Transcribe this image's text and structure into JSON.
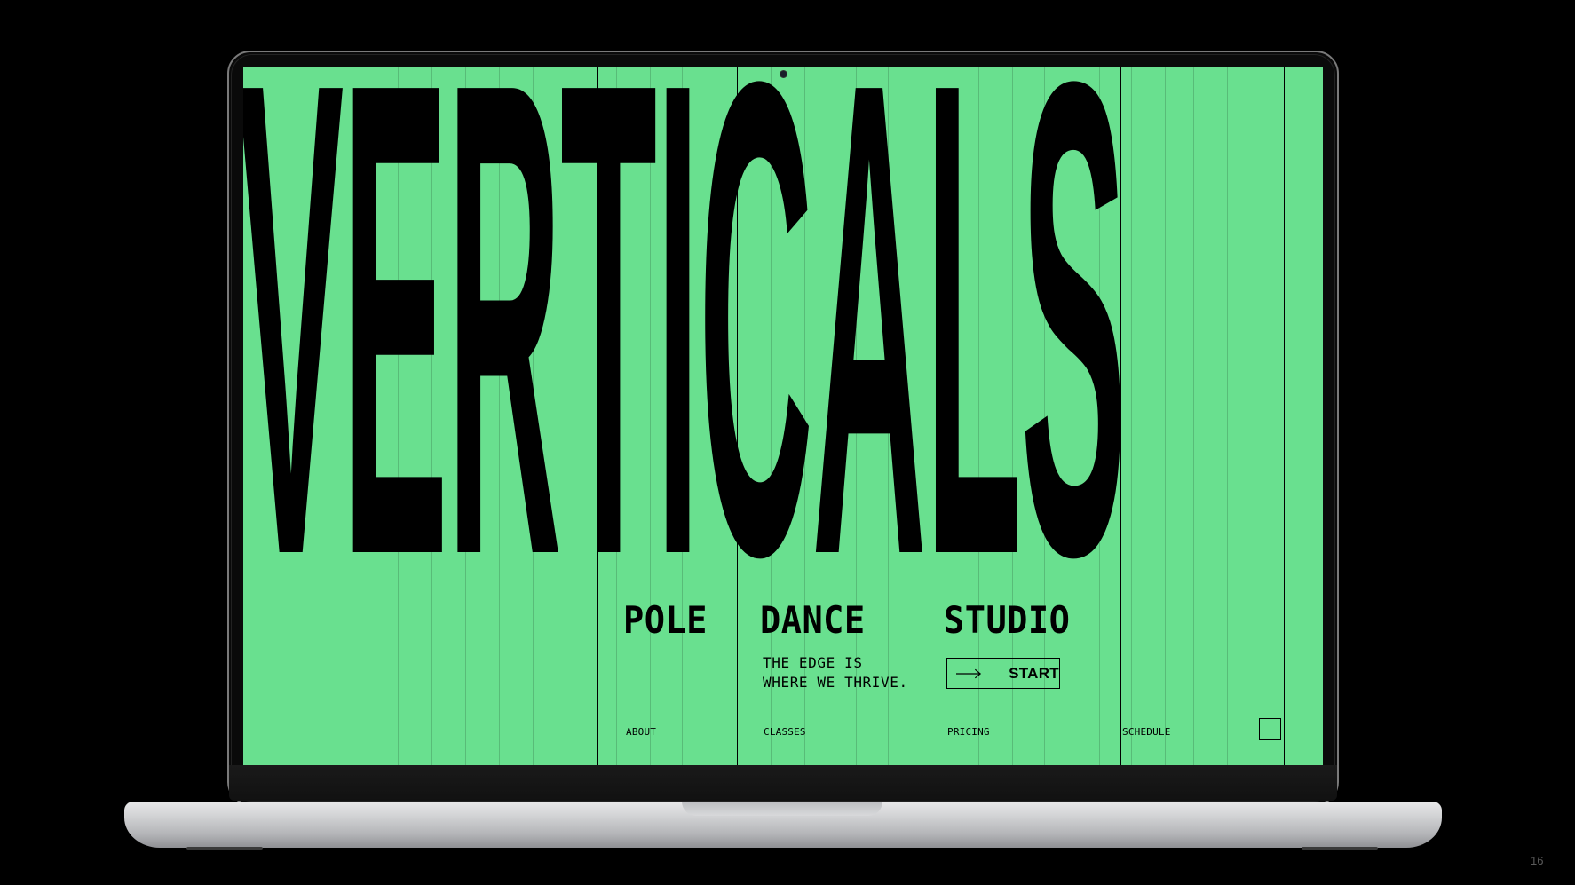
{
  "site": {
    "title": "VERTICALS",
    "headline": {
      "word1": "POLE",
      "word2": "DANCE",
      "word3": "STUDIO"
    },
    "tagline": {
      "line1": "THE EDGE IS",
      "line2": "WHERE WE THRIVE."
    },
    "cta": {
      "label": "START",
      "icon": "arrow-right-icon"
    },
    "nav": {
      "about": "ABOUT",
      "classes": "CLASSES",
      "pricing": "PRICING",
      "schedule": "SCHEDULE"
    },
    "menu_icon": "square-menu-icon"
  },
  "colors": {
    "background": "#000000",
    "screen": "#69e08f",
    "ink": "#000000"
  },
  "slide": {
    "page_number": "16"
  }
}
